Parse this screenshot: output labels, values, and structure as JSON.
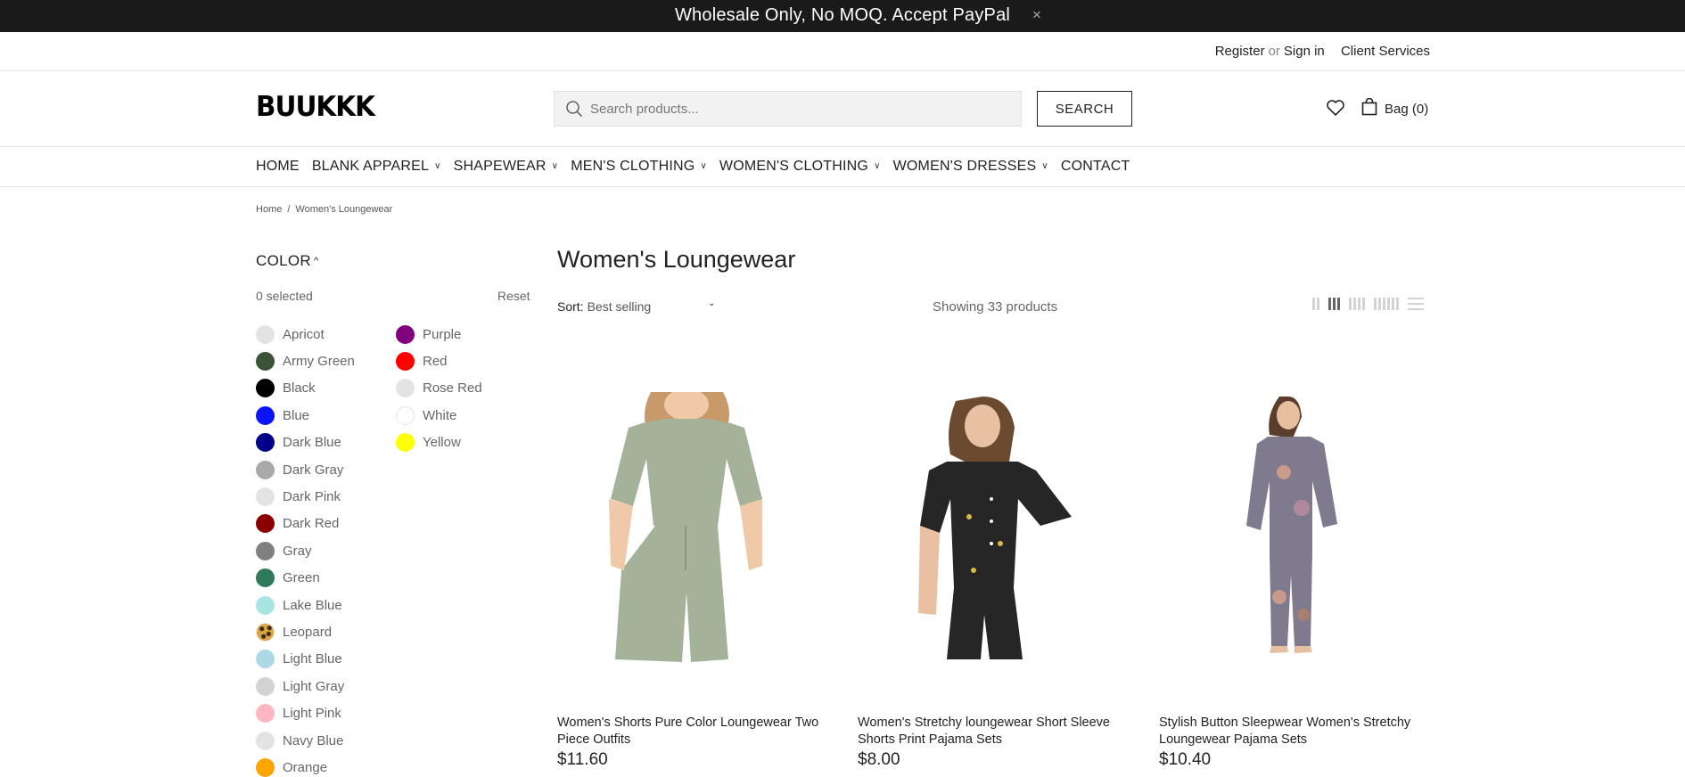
{
  "announcement": {
    "text": "Wholesale Only, No MOQ. Accept PayPal",
    "close": "×"
  },
  "topbar": {
    "register": "Register",
    "or": "or",
    "signin": "Sign in",
    "client_services": "Client Services"
  },
  "header": {
    "logo": "BUUKKK",
    "search_placeholder": "Search products...",
    "search_button": "SEARCH",
    "bag_label": "Bag (0)"
  },
  "nav": {
    "items": [
      {
        "label": "HOME",
        "dropdown": false
      },
      {
        "label": "BLANK APPAREL",
        "dropdown": true
      },
      {
        "label": "SHAPEWEAR",
        "dropdown": true
      },
      {
        "label": "MEN'S CLOTHING",
        "dropdown": true
      },
      {
        "label": "WOMEN'S CLOTHING",
        "dropdown": true
      },
      {
        "label": "WOMEN'S DRESSES",
        "dropdown": true
      },
      {
        "label": "CONTACT",
        "dropdown": false
      }
    ]
  },
  "breadcrumb": {
    "home": "Home",
    "current": "Women's Loungewear"
  },
  "filter": {
    "title": "COLOR",
    "selected": "0 selected",
    "reset": "Reset",
    "colors_col1": [
      {
        "name": "Apricot",
        "color": "#e3e3e3"
      },
      {
        "name": "Army Green",
        "color": "#3d5338"
      },
      {
        "name": "Black",
        "color": "#000000"
      },
      {
        "name": "Blue",
        "color": "#0a14f5"
      },
      {
        "name": "Dark Blue",
        "color": "#00008b"
      },
      {
        "name": "Dark Gray",
        "color": "#a9a9a9"
      },
      {
        "name": "Dark Pink",
        "color": "#e3e3e3"
      },
      {
        "name": "Dark Red",
        "color": "#8b0000"
      },
      {
        "name": "Gray",
        "color": "#808080"
      },
      {
        "name": "Green",
        "color": "#2f7a5a"
      },
      {
        "name": "Lake Blue",
        "color": "#a8e4e4"
      },
      {
        "name": "Leopard",
        "color": "leopard"
      },
      {
        "name": "Light Blue",
        "color": "#add8e6"
      },
      {
        "name": "Light Gray",
        "color": "#d3d3d3"
      },
      {
        "name": "Light Pink",
        "color": "#ffb6c1"
      },
      {
        "name": "Navy Blue",
        "color": "#e3e3e3"
      },
      {
        "name": "Orange",
        "color": "#ffa500"
      }
    ],
    "colors_col2": [
      {
        "name": "Purple",
        "color": "#800080"
      },
      {
        "name": "Red",
        "color": "#ff0000"
      },
      {
        "name": "Rose Red",
        "color": "#e3e3e3"
      },
      {
        "name": "White",
        "color": "#ffffff"
      },
      {
        "name": "Yellow",
        "color": "#ffff00"
      }
    ]
  },
  "main": {
    "title": "Women's Loungewear",
    "sort_label": "Sort:",
    "sort_value": "Best selling",
    "showing": "Showing 33 products"
  },
  "products": [
    {
      "name": "Women's Shorts Pure Color Loungewear Two Piece Outfits",
      "price": "$11.60"
    },
    {
      "name": "Women's Stretchy loungewear Short Sleeve Shorts Print Pajama Sets",
      "price": "$8.00"
    },
    {
      "name": "Stylish Button Sleepwear Women's Stretchy Loungewear Pajama Sets",
      "price": "$10.40"
    }
  ]
}
